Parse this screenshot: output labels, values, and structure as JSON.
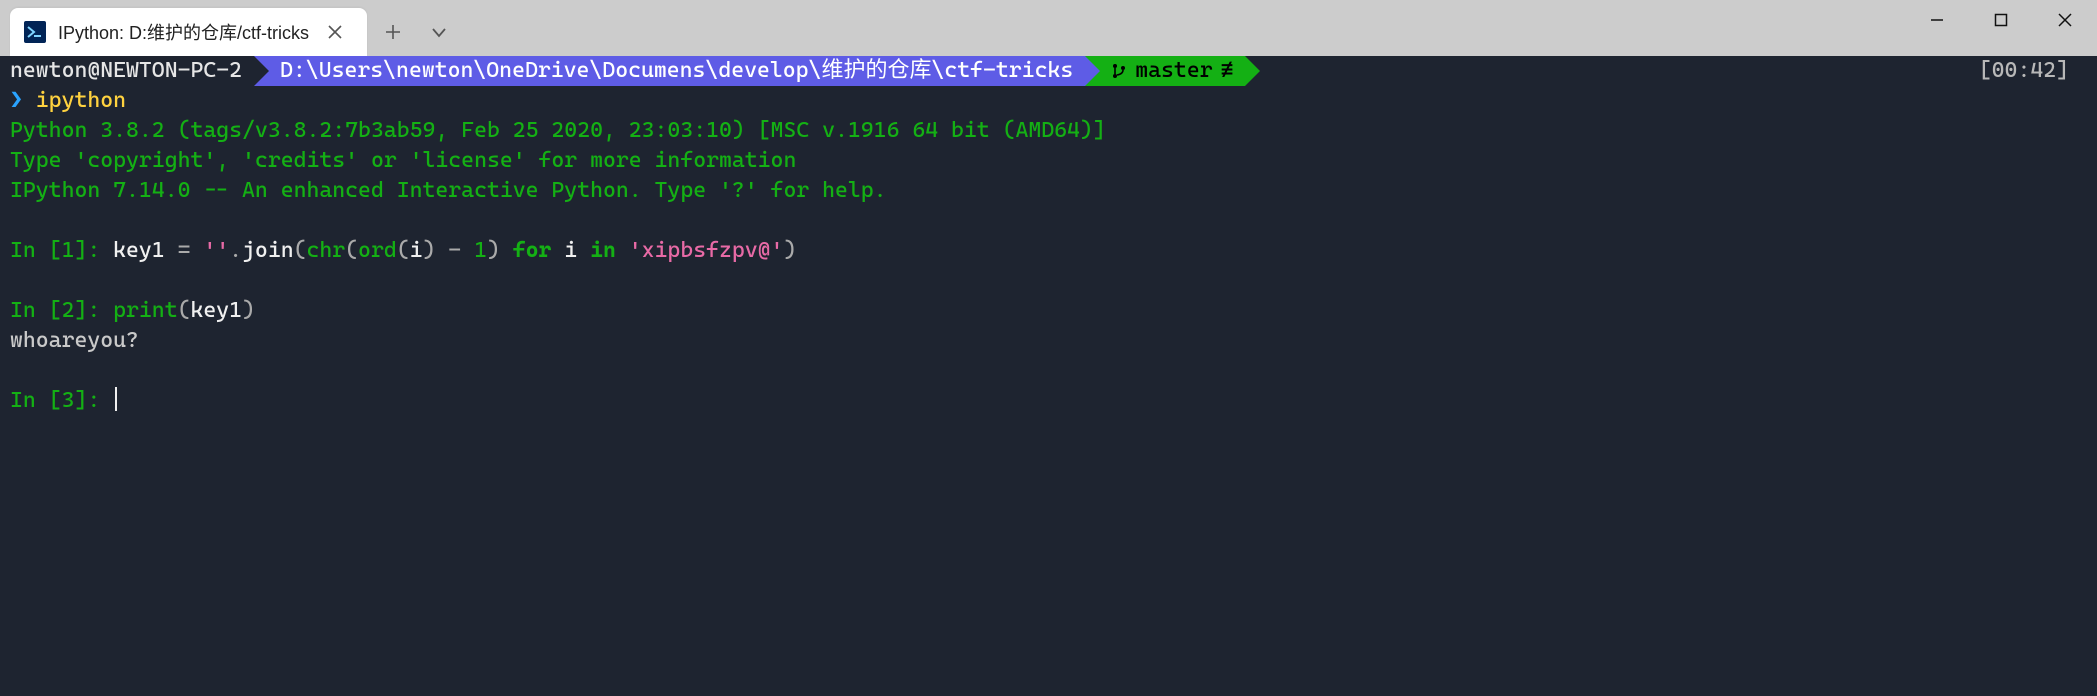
{
  "titlebar": {
    "tab_title": "IPython: D:维护的仓库/ctf-tricks"
  },
  "powerline": {
    "host": "newton@NEWTON-PC-2",
    "path": "D:\\Users\\newton\\OneDrive\\Documens\\develop\\维护的仓库\\ctf-tricks",
    "git_branch": "master",
    "git_sep": "≢",
    "time": "[00:42]"
  },
  "prompt": {
    "sym": "❯",
    "cmd": "ipython"
  },
  "banner": {
    "l1": "Python 3.8.2 (tags/v3.8.2:7b3ab59, Feb 25 2020, 23:03:10) [MSC v.1916 64 bit (AMD64)]",
    "l2": "Type 'copyright', 'credits' or 'license' for more information",
    "l3": "IPython 7.14.0 -- An enhanced Interactive Python. Type '?' for help."
  },
  "cells": {
    "in1_prompt": "In [1]: ",
    "in1": {
      "var": "key1",
      "eq": " = ",
      "empty": "''",
      "dot": ".",
      "join": "join",
      "op1": "(",
      "chr": "chr",
      "op2": "(",
      "ord": "ord",
      "op3": "(",
      "i1": "i",
      "op4": ")",
      "minus": " - ",
      "one": "1",
      "op5": ")",
      "for": " for ",
      "i2": "i",
      "in": " in ",
      "s": "'xipbsfzpv@'",
      "op6": ")"
    },
    "in2_prompt": "In [2]: ",
    "in2": {
      "print": "print",
      "op1": "(",
      "arg": "key1",
      "op2": ")"
    },
    "out2": "whoareyou?",
    "in3_prompt": "In [3]: "
  }
}
